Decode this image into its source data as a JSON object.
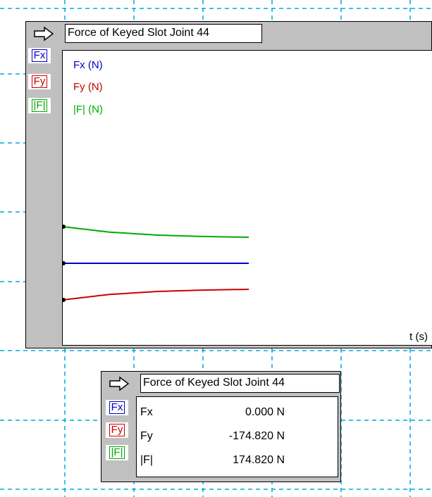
{
  "colors": {
    "fx": "#0000cc",
    "fy": "#cc0000",
    "fmag": "#00aa00",
    "grid": "#00a8e0",
    "panel": "#c0c0c0"
  },
  "graph_window": {
    "title": "Force of Keyed Slot Joint 44",
    "buttons": {
      "fx": "Fx",
      "fy": "Fy",
      "fmag": "|F|"
    },
    "legend": {
      "fx": "Fx (N)",
      "fy": "Fy (N)",
      "fmag": "|F| (N)"
    },
    "x_axis_label": "t (s)",
    "menu_icon": "arrow-right-icon"
  },
  "meter_window": {
    "title": "Force of Keyed Slot Joint 44",
    "buttons": {
      "fx": "Fx",
      "fy": "Fy",
      "fmag": "|F|"
    },
    "rows": [
      {
        "label": "Fx",
        "value": "0.000 N"
      },
      {
        "label": "Fy",
        "value": "-174.820 N"
      },
      {
        "label": "|F|",
        "value": "174.820 N"
      }
    ],
    "menu_icon": "arrow-right-icon"
  },
  "chart_data": {
    "type": "line",
    "xlabel": "t (s)",
    "series": [
      {
        "name": "Fx (N)",
        "x": [
          0,
          0.25,
          0.5,
          0.75,
          1.0
        ],
        "values": [
          0,
          0,
          0,
          0,
          0
        ]
      },
      {
        "name": "Fy (N)",
        "x": [
          0,
          0.25,
          0.5,
          0.75,
          1.0
        ],
        "values": [
          -250,
          -213,
          -193,
          -183,
          -178
        ]
      },
      {
        "name": "|F| (N)",
        "x": [
          0,
          0.25,
          0.5,
          0.75,
          1.0
        ],
        "values": [
          250,
          213,
          193,
          183,
          178
        ]
      }
    ]
  }
}
